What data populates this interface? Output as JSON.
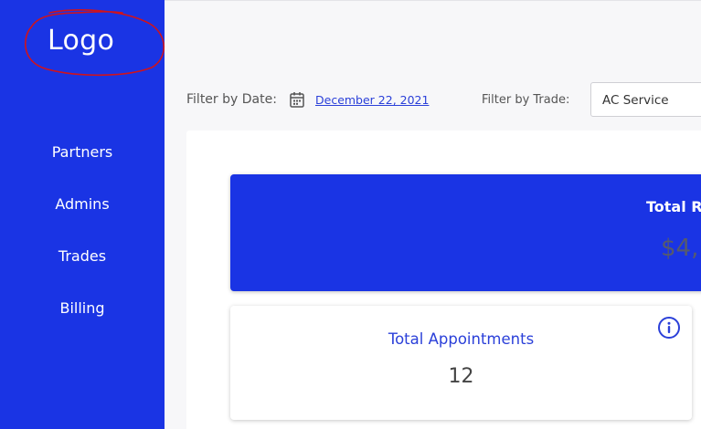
{
  "sidebar": {
    "logo_text": "Logo",
    "items": [
      {
        "label": "Partners"
      },
      {
        "label": "Admins"
      },
      {
        "label": "Trades"
      },
      {
        "label": "Billing"
      }
    ]
  },
  "filters": {
    "date_label": "Filter by Date:",
    "date_value": "December 22, 2021",
    "date_icon": "calendar-icon",
    "trade_label": "Filter by Trade:",
    "trade_value": "AC Service"
  },
  "cards": {
    "revenue": {
      "title": "Total R",
      "value": "$4,"
    },
    "appointments": {
      "title": "Total Appointments",
      "value": "12",
      "icon": "info-icon"
    }
  },
  "colors": {
    "primary": "#1a34e4",
    "link": "#2b40d9",
    "annotation": "#d0131c"
  }
}
